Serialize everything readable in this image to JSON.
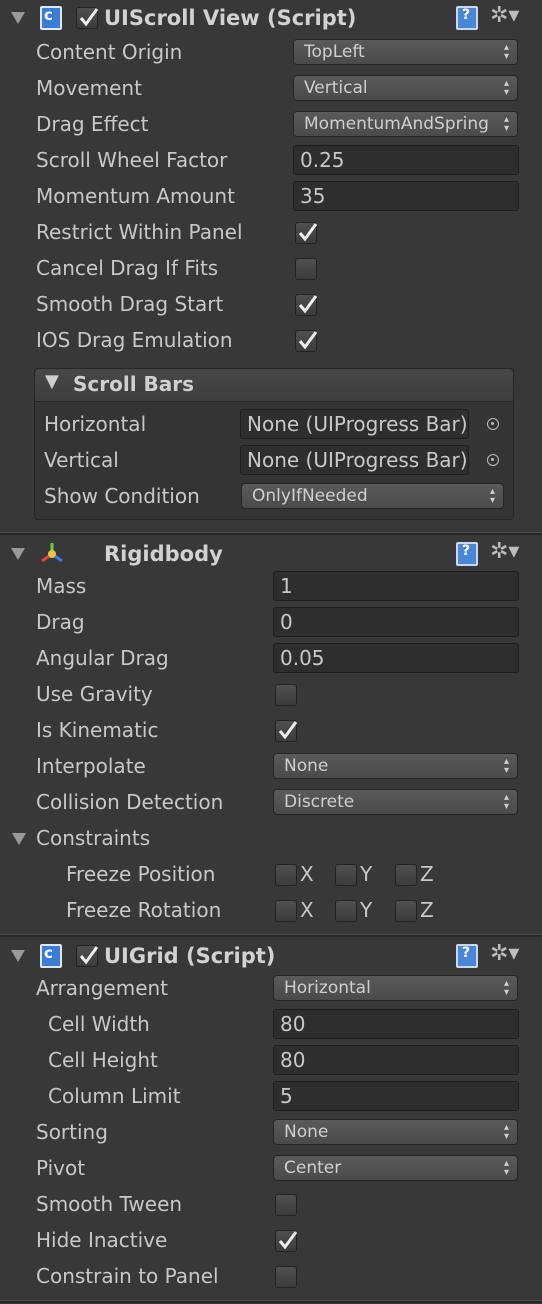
{
  "scroll_view": {
    "title": "UIScroll View (Script)",
    "content_origin_label": "Content Origin",
    "content_origin_value": "TopLeft",
    "movement_label": "Movement",
    "movement_value": "Vertical",
    "drag_effect_label": "Drag Effect",
    "drag_effect_value": "MomentumAndSpring",
    "scroll_wheel_label": "Scroll Wheel Factor",
    "scroll_wheel_value": "0.25",
    "momentum_label": "Momentum Amount",
    "momentum_value": "35",
    "restrict_label": "Restrict Within Panel",
    "restrict_checked": true,
    "cancel_drag_label": "Cancel Drag If Fits",
    "cancel_drag_checked": false,
    "smooth_drag_label": "Smooth Drag Start",
    "smooth_drag_checked": true,
    "ios_drag_label": "IOS Drag Emulation",
    "ios_drag_checked": true,
    "scroll_bars": {
      "title": "Scroll Bars",
      "horizontal_label": "Horizontal",
      "horizontal_value": "None (UIProgress Bar)",
      "vertical_label": "Vertical",
      "vertical_value": "None (UIProgress Bar)",
      "show_condition_label": "Show Condition",
      "show_condition_value": "OnlyIfNeeded"
    }
  },
  "rigidbody": {
    "title": "Rigidbody",
    "mass_label": "Mass",
    "mass_value": "1",
    "drag_label": "Drag",
    "drag_value": "0",
    "angular_drag_label": "Angular Drag",
    "angular_drag_value": "0.05",
    "use_gravity_label": "Use Gravity",
    "use_gravity_checked": false,
    "is_kinematic_label": "Is Kinematic",
    "is_kinematic_checked": true,
    "interpolate_label": "Interpolate",
    "interpolate_value": "None",
    "collision_label": "Collision Detection",
    "collision_value": "Discrete",
    "constraints_label": "Constraints",
    "freeze_position_label": "Freeze Position",
    "freeze_rotation_label": "Freeze Rotation",
    "axis_x": "X",
    "axis_y": "Y",
    "axis_z": "Z"
  },
  "grid": {
    "title": "UIGrid (Script)",
    "arrangement_label": "Arrangement",
    "arrangement_value": "Horizontal",
    "cell_width_label": "Cell Width",
    "cell_width_value": "80",
    "cell_height_label": "Cell Height",
    "cell_height_value": "80",
    "column_limit_label": "Column Limit",
    "column_limit_value": "5",
    "sorting_label": "Sorting",
    "sorting_value": "None",
    "pivot_label": "Pivot",
    "pivot_value": "Center",
    "smooth_tween_label": "Smooth Tween",
    "smooth_tween_checked": false,
    "hide_inactive_label": "Hide Inactive",
    "hide_inactive_checked": true,
    "constrain_label": "Constrain to Panel",
    "constrain_checked": false
  },
  "icons": {
    "script": "csharp-script-icon",
    "help": "help-book-icon",
    "settings": "gear-icon",
    "rigidbody": "rigidbody-axes-icon",
    "object_picker": "object-picker-icon"
  }
}
